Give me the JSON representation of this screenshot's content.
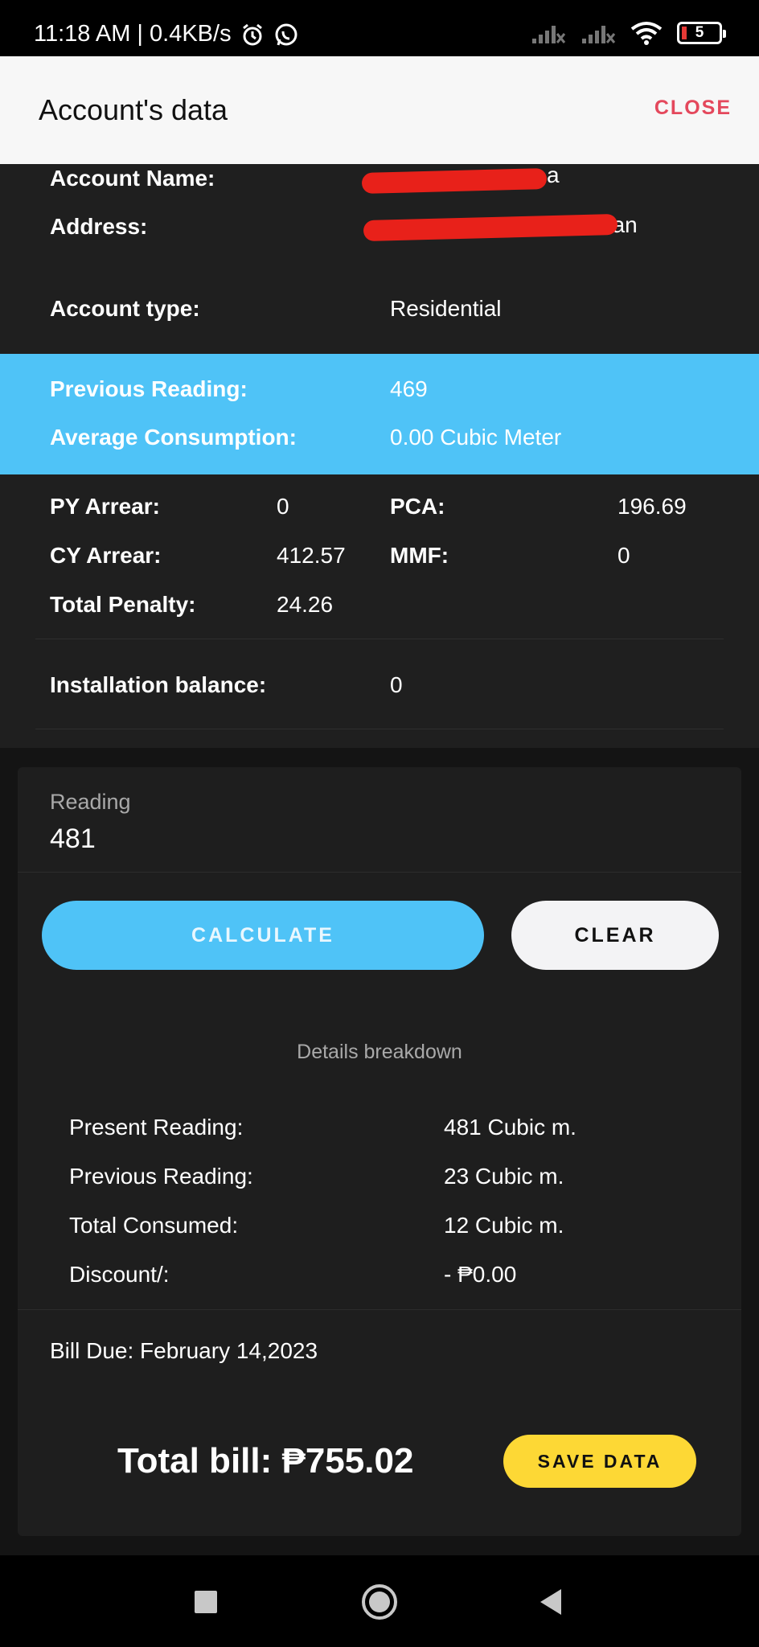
{
  "status_bar": {
    "time_speed": "11:18 AM | 0.4KB/s",
    "battery_level": "5"
  },
  "header": {
    "title": "Account's data",
    "close_label": "CLOSE"
  },
  "account": {
    "name_label": "Account Name:",
    "name_visible_fragment": "a",
    "address_label": "Address:",
    "address_visible_fragment": "Dunican",
    "type_label": "Account type:",
    "type_value": "Residential"
  },
  "readings": {
    "previous_label": "Previous Reading:",
    "previous_value": "469",
    "average_label": "Average Consumption:",
    "average_value": "0.00 Cubic Meter"
  },
  "charges": {
    "py_arrear_label": "PY Arrear:",
    "py_arrear_value": "0",
    "pca_label": "PCA:",
    "pca_value": "196.69",
    "cy_arrear_label": "CY Arrear:",
    "cy_arrear_value": "412.57",
    "mmf_label": "MMF:",
    "mmf_value": "0",
    "penalty_label": "Total Penalty:",
    "penalty_value": "24.26",
    "installation_label": "Installation balance:",
    "installation_value": "0"
  },
  "calculator": {
    "reading_label": "Reading",
    "reading_value": "481",
    "calculate_label": "CALCULATE",
    "clear_label": "CLEAR"
  },
  "breakdown": {
    "title": "Details breakdown",
    "rows": [
      {
        "label": "Present Reading:",
        "value": "481 Cubic m."
      },
      {
        "label": "Previous Reading:",
        "value": "23 Cubic m."
      },
      {
        "label": "Total Consumed:",
        "value": "12 Cubic m."
      },
      {
        "label": "Discount/:",
        "value": "- ₱0.00"
      }
    ]
  },
  "bill": {
    "due": "Bill Due: February 14,2023",
    "total": "Total bill: ₱755.02",
    "save_label": "SAVE DATA"
  },
  "colors": {
    "accent_blue": "#4fc3f7",
    "close_red": "#e4485c",
    "save_yellow": "#fdd835"
  }
}
